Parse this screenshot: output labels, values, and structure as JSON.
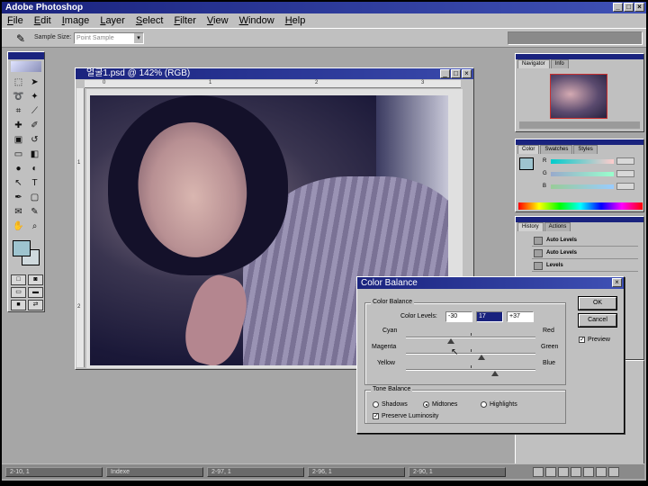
{
  "app": {
    "title": "Adobe Photoshop"
  },
  "menu": [
    "File",
    "Edit",
    "Image",
    "Layer",
    "Select",
    "Filter",
    "View",
    "Window",
    "Help"
  ],
  "options": {
    "sample_size_label": "Sample Size:",
    "sample_size_value": "Point Sample"
  },
  "document": {
    "title": "얼굴1.psd @ 142% (RGB)",
    "ruler_h": [
      "0",
      "1",
      "2",
      "3"
    ],
    "ruler_v": [
      "1",
      "2"
    ]
  },
  "panels": {
    "navigator_tabs": [
      "Navigator",
      "Info"
    ],
    "color_tabs": [
      "Color",
      "Swatches",
      "Styles"
    ],
    "color_rows": [
      "R",
      "G",
      "B"
    ],
    "history_tabs": [
      "History",
      "Actions"
    ],
    "history_items": [
      "Auto Levels",
      "Auto Levels",
      "Levels"
    ]
  },
  "dialog": {
    "title": "Color Balance",
    "group1_label": "Color Balance",
    "levels_label": "Color Levels:",
    "levels": [
      "-30",
      "17",
      "+37"
    ],
    "sliders": [
      {
        "left": "Cyan",
        "right": "Red",
        "value": -30
      },
      {
        "left": "Magenta",
        "right": "Green",
        "value": 17
      },
      {
        "left": "Yellow",
        "right": "Blue",
        "value": 37
      }
    ],
    "group2_label": "Tone Balance",
    "tones": [
      "Shadows",
      "Midtones",
      "Highlights"
    ],
    "selected_tone": "Midtones",
    "preserve_label": "Preserve Luminosity",
    "ok_label": "OK",
    "cancel_label": "Cancel",
    "preview_label": "Preview"
  },
  "taskbar": {
    "items": [
      "2-10, 1",
      "Indexe",
      "2-97, 1",
      "2-96, 1",
      "2-90, 1"
    ]
  }
}
